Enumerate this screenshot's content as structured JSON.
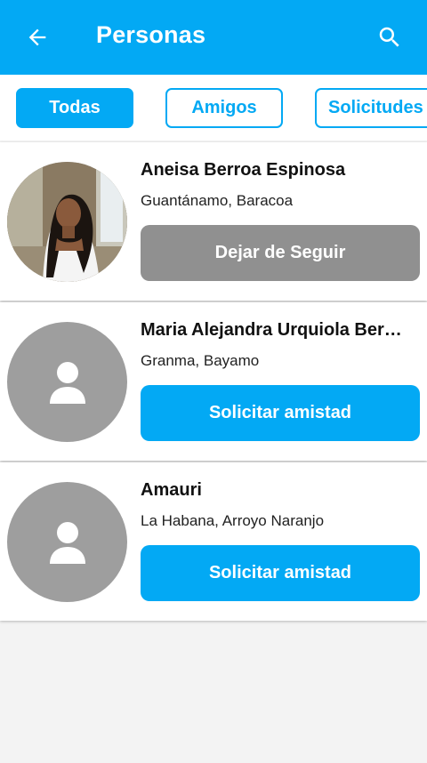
{
  "header": {
    "title": "Personas",
    "back_icon": "arrow-back-icon",
    "search_icon": "search-icon",
    "color": "#03a9f4"
  },
  "tabs": [
    {
      "label": "Todas",
      "active": true
    },
    {
      "label": "Amigos",
      "active": false
    },
    {
      "label": "Solicitudes Recibidas",
      "active": false
    }
  ],
  "people": [
    {
      "name": "Aneisa Berroa Espinosa",
      "location": "Guantánamo, Baracoa",
      "action_label": "Dejar de Seguir",
      "avatar": "photo"
    },
    {
      "name": "Maria Alejandra Urquiola Berroa",
      "location": "Granma, Bayamo",
      "action_label": "Solicitar amistad",
      "avatar": "person-placeholder-icon"
    },
    {
      "name": "Amauri",
      "location": "La Habana, Arroyo Naranjo",
      "action_label": "Solicitar amistad",
      "avatar": "person-placeholder-icon"
    }
  ],
  "colors": {
    "accent": "#03a9f4",
    "unfollow_button": "#909090",
    "avatar_placeholder": "#9e9e9e"
  }
}
